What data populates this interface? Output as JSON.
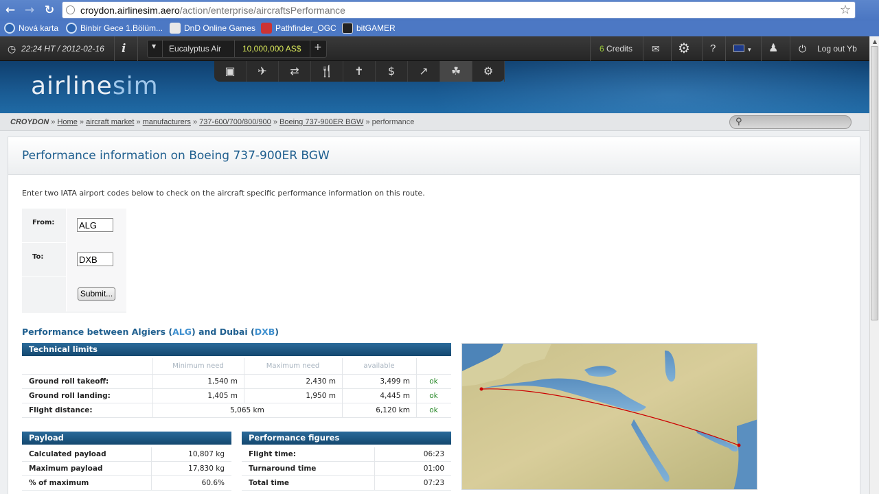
{
  "browser": {
    "url_host": "croydon.airlinesim.aero",
    "url_path": "/action/enterprise/aircraftsPerformance",
    "bookmarks": [
      "Nová karta",
      "Binbir Gece 1.Bölüm...",
      "DnD Online Games",
      "Pathfinder_OGC",
      "bitGAMER"
    ]
  },
  "topbar": {
    "time": "22:24 HT",
    "date": "/ 2012-02-16",
    "info": "i",
    "airline": "Eucalyptus Air",
    "balance": "10,000,000 AS$",
    "plus": "+",
    "credits_count": "6",
    "credits_label": "Credits",
    "help": "?",
    "logout": "Log out Yb"
  },
  "logo": {
    "part1": "airline",
    "part2": "sim"
  },
  "breadcrumb": {
    "root": "CROYDON",
    "sep": "»",
    "links": [
      "Home",
      "aircraft market",
      "manufacturers",
      "737-600/700/800/900",
      "Boeing 737-900ER BGW"
    ],
    "current": "performance"
  },
  "page": {
    "title": "Performance information on Boeing 737-900ER BGW",
    "intro": "Enter two IATA airport codes below to check on the aircraft specific performance information on this route."
  },
  "form": {
    "from_label": "From:",
    "from_value": "ALG",
    "to_label": "To:",
    "to_value": "DXB",
    "submit": "Submit..."
  },
  "perf": {
    "prefix": "Performance between Algiers (",
    "from_code": "ALG",
    "middle": ") and Dubai (",
    "to_code": "DXB",
    "suffix": ")"
  },
  "technical": {
    "title": "Technical limits",
    "headers": [
      "Minimum need",
      "Maximum need",
      "available"
    ],
    "rows": [
      {
        "label": "Ground roll takeoff:",
        "min": "1,540 m",
        "max": "2,430 m",
        "available": "3,499 m",
        "status": "ok"
      },
      {
        "label": "Ground roll landing:",
        "min": "1,405 m",
        "max": "1,950 m",
        "available": "4,445 m",
        "status": "ok"
      }
    ],
    "distance": {
      "label": "Flight distance:",
      "value": "5,065 km",
      "available": "6,120 km",
      "status": "ok"
    }
  },
  "payload": {
    "title": "Payload",
    "rows": [
      {
        "label": "Calculated payload",
        "value": "10,807 kg"
      },
      {
        "label": "Maximum payload",
        "value": "17,830 kg"
      },
      {
        "label": "% of maximum",
        "value": "60.6%"
      }
    ]
  },
  "figures": {
    "title": "Performance figures",
    "rows": [
      {
        "label": "Flight time:",
        "value": "06:23"
      },
      {
        "label": "Turnaround time",
        "value": "01:00"
      },
      {
        "label": "Total time",
        "value": "07:23"
      }
    ]
  },
  "colors": {
    "accent": "#1f5f8f",
    "ok": "#2a8a2a",
    "route": "#cc0000"
  }
}
